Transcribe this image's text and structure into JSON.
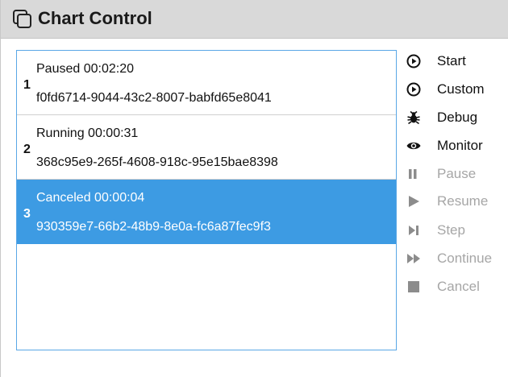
{
  "window": {
    "title": "Chart Control",
    "icon": "window-copy-icon"
  },
  "runs": [
    {
      "index": "1",
      "status": "Paused 00:02:20",
      "id": "f0fd6714-9044-43c2-8007-babfd65e8041",
      "selected": false
    },
    {
      "index": "2",
      "status": "Running 00:00:31",
      "id": "368c95e9-265f-4608-918c-95e15bae8398",
      "selected": false
    },
    {
      "index": "3",
      "status": "Canceled 00:00:04",
      "id": "930359e7-66b2-48b9-8e0a-fc6a87fec9f3",
      "selected": true
    }
  ],
  "actions": [
    {
      "label": "Start",
      "icon": "start-icon",
      "enabled": true
    },
    {
      "label": "Custom",
      "icon": "custom-icon",
      "enabled": true
    },
    {
      "label": "Debug",
      "icon": "bug-icon",
      "enabled": true
    },
    {
      "label": "Monitor",
      "icon": "eye-icon",
      "enabled": true
    },
    {
      "label": "Pause",
      "icon": "pause-icon",
      "enabled": false
    },
    {
      "label": "Resume",
      "icon": "play-icon",
      "enabled": false
    },
    {
      "label": "Step",
      "icon": "step-icon",
      "enabled": false
    },
    {
      "label": "Continue",
      "icon": "fast-forward-icon",
      "enabled": false
    },
    {
      "label": "Cancel",
      "icon": "stop-icon",
      "enabled": false
    }
  ],
  "colors": {
    "selection": "#3d9be3",
    "list_border": "#5aa7e6",
    "titlebar": "#d9d9d9",
    "disabled_text": "#a6a6a6"
  }
}
